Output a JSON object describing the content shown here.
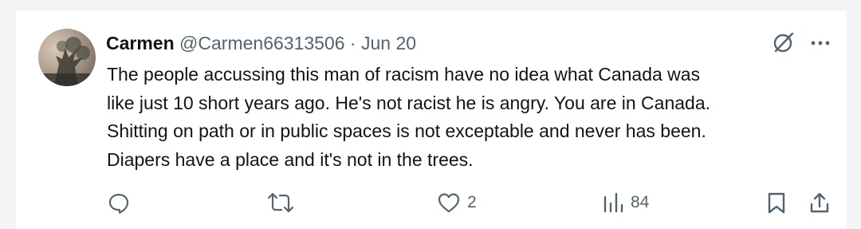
{
  "tweet": {
    "author_name": "Carmen",
    "handle": "@Carmen66313506",
    "separator": "·",
    "date": "Jun 20",
    "text_lines": [
      "The people accussing this man of racism have no idea what Canada was",
      "like just 10 short years ago. He's not racist he is angry. You are in Canada.",
      "Shitting on path or in public spaces is not exceptable and never has been.",
      "Diapers have a place and it's not in the trees."
    ]
  },
  "actions": {
    "reply_count": "",
    "repost_count": "",
    "like_count": "2",
    "views_count": "84"
  },
  "icons": {
    "grok": "grok-icon",
    "more": "more-icon",
    "reply": "reply-icon",
    "repost": "repost-icon",
    "like": "heart-icon",
    "views": "views-icon",
    "bookmark": "bookmark-icon",
    "share": "share-icon"
  },
  "colors": {
    "text": "#0f1419",
    "muted": "#536471",
    "background": "#ffffff"
  }
}
